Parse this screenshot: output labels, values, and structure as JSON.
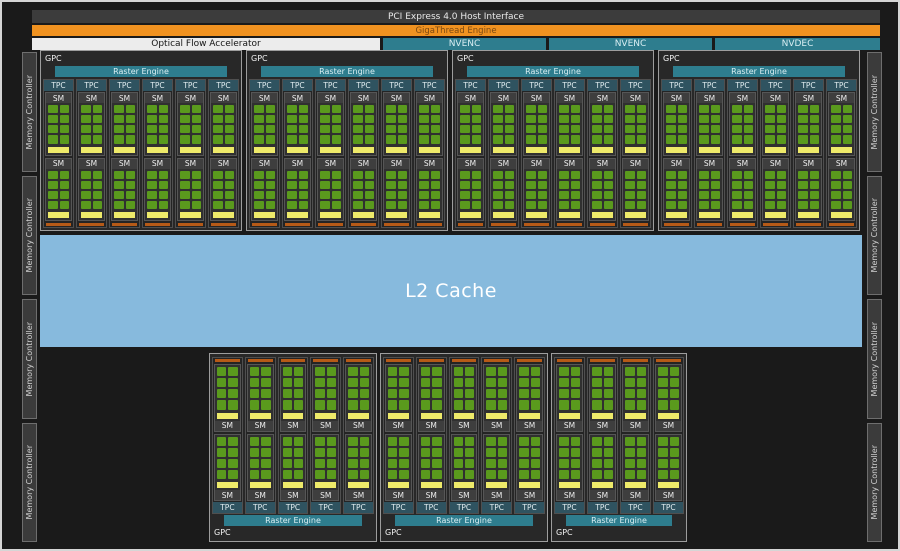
{
  "title": "GPU die block diagram",
  "colors": {
    "background": "#1a1a1a",
    "orange_bar": "#f09220",
    "teal": "#2e7d8e",
    "core_green": "#5a9a1d",
    "unit_yellow": "#eeea6a",
    "texture_orange": "#b65a17",
    "l2_blue": "#87badd",
    "block_gray": "#3b3b3b"
  },
  "top_bars": {
    "pci": "PCI Express 4.0 Host Interface",
    "gigathread": "GigaThread Engine",
    "ofa": "Optical Flow Accelerator",
    "nvenc_left": "NVENC",
    "nvenc_right": "NVENC",
    "nvdec": "NVDEC"
  },
  "labels": {
    "gpc": "GPC",
    "raster_engine": "Raster Engine",
    "tpc": "TPC",
    "sm": "SM",
    "l2_cache": "L2 Cache",
    "memory_controller": "Memory Controller"
  },
  "structure": {
    "top_gpcs": [
      {
        "tpc_count": 6
      },
      {
        "tpc_count": 6
      },
      {
        "tpc_count": 6
      },
      {
        "tpc_count": 6
      }
    ],
    "bottom_gpcs": [
      {
        "tpc_count": 5
      },
      {
        "tpc_count": 5
      },
      {
        "tpc_count": 4
      }
    ],
    "sms_per_tpc": 2,
    "green_cells_per_sm": {
      "rows": 4,
      "cols": 2
    },
    "memory_controllers_per_side": 4
  }
}
